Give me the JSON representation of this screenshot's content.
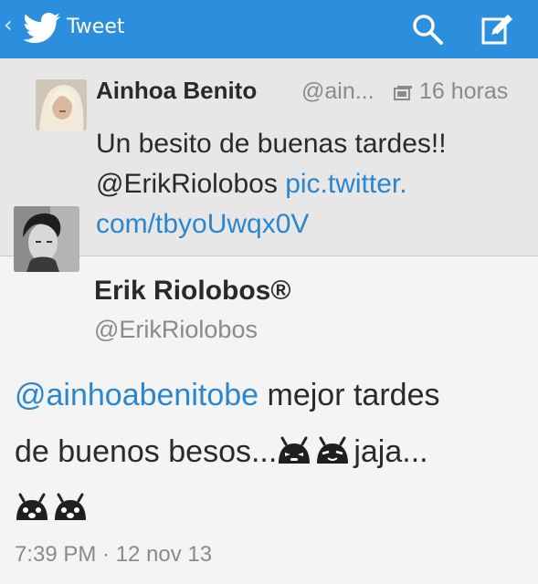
{
  "colors": {
    "topbar": "#2c8fde",
    "link": "#2a86cf",
    "muted": "#8a8a8a",
    "quoted_bg": "#e7e7e7"
  },
  "header": {
    "back_icon": "chevron-left-icon",
    "logo_icon": "twitter-bird-icon",
    "title": "Tweet",
    "search_icon": "search-icon",
    "compose_icon": "compose-icon"
  },
  "original_tweet": {
    "name": "Ainhoa Benito",
    "handle": "@ain...",
    "media_icon": "media-icon",
    "time": "16 horas",
    "text_line1": "Un besito de buenas tardes!!",
    "mention": "@ErikRiolobos",
    "link_part1": "pic.twitter.",
    "link_part2": "com/tbyoUwqx0V"
  },
  "reply_tweet": {
    "name": "Erik Riolobos®",
    "handle": "@ErikRiolobos",
    "mention": "@ainhoabenitobe",
    "text_a": " mejor tardes",
    "text_b": "de buenos besos...",
    "text_c": "jaja...",
    "emoji_icon": "android-face-emoji-icon",
    "timestamp": "7:39 PM · 12 nov 13"
  }
}
